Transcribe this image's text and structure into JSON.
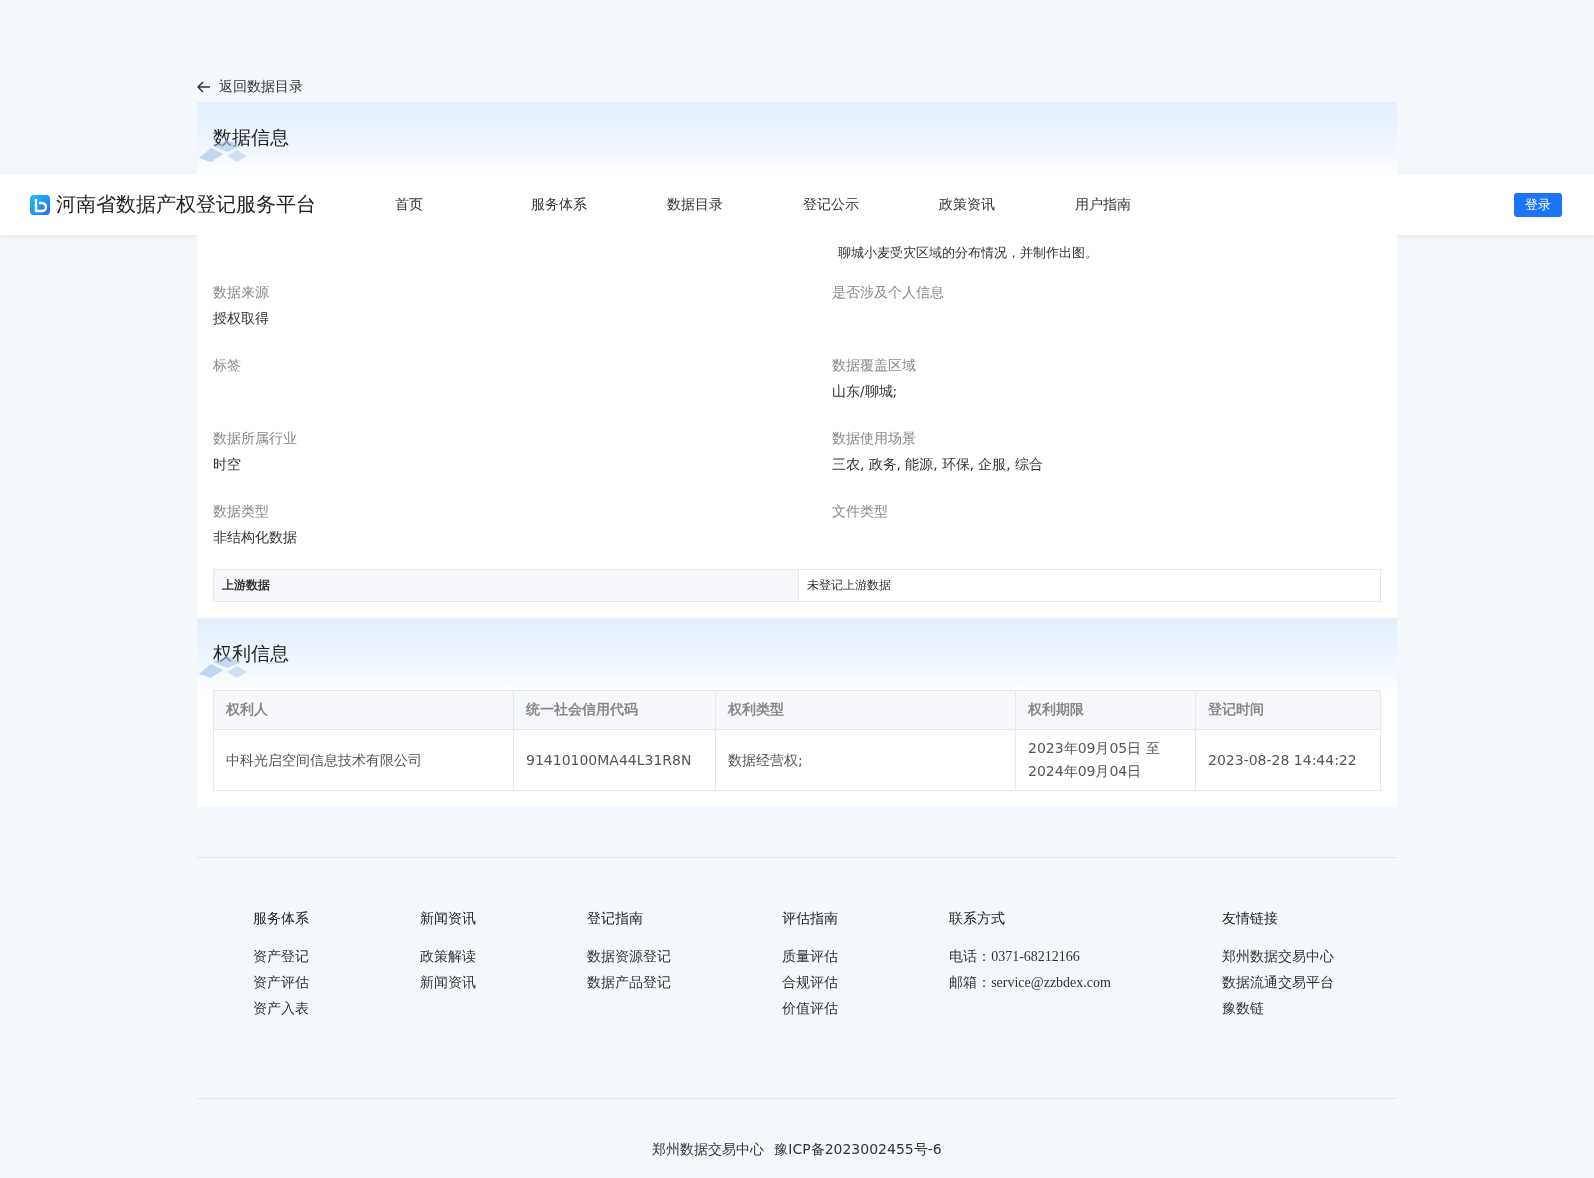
{
  "back_link": {
    "label": "返回数据目录"
  },
  "data_info": {
    "title": "数据信息",
    "description_tail": "聊城小麦受灾区域的分布情况，并制作出图。",
    "fields": [
      {
        "label": "数据来源",
        "value": "授权取得"
      },
      {
        "label": "是否涉及个人信息"
      },
      {
        "label": "标签"
      },
      {
        "label": "数据覆盖区域",
        "value": "山东/聊城;"
      },
      {
        "label": "数据所属行业",
        "value": "时空"
      },
      {
        "label": "数据使用场景",
        "value": "三农, 政务, 能源, 环保, 企服, 综合"
      },
      {
        "label": "数据类型",
        "value": "非结构化数据"
      },
      {
        "label": "文件类型"
      }
    ],
    "upstream": {
      "label": "上游数据",
      "value": "未登记上游数据"
    }
  },
  "header": {
    "logo_text": "河南省数据产权登记服务平台",
    "nav": [
      {
        "label": "首页"
      },
      {
        "label": "服务体系"
      },
      {
        "label": "数据目录"
      },
      {
        "label": "登记公示"
      },
      {
        "label": "政策资讯"
      },
      {
        "label": "用户指南"
      }
    ],
    "login": "登录"
  },
  "rights_info": {
    "title": "权利信息",
    "columns": [
      "权利人",
      "统一社会信用代码",
      "权利类型",
      "权利期限",
      "登记时间"
    ],
    "rows": [
      [
        "中科光启空间信息技术有限公司",
        "91410100MA44L31R8N",
        "数据经营权;",
        "2023年09月05日 至 2024年09月04日",
        "2023-08-28 14:44:22"
      ]
    ]
  },
  "footer": {
    "columns": [
      {
        "title": "服务体系",
        "links": [
          "资产登记",
          "资产评估",
          "资产入表"
        ]
      },
      {
        "title": "新闻资讯",
        "links": [
          "政策解读",
          "新闻资讯"
        ]
      },
      {
        "title": "登记指南",
        "links": [
          "数据资源登记",
          "数据产品登记"
        ]
      },
      {
        "title": "评估指南",
        "links": [
          "质量评估",
          "合规评估",
          "价值评估"
        ]
      },
      {
        "title": "联系方式",
        "links": [
          "电话：0371-68212166",
          "邮箱：service@zzbdex.com"
        ]
      },
      {
        "title": "友情链接",
        "links": [
          "郑州数据交易中心",
          "数据流通交易平台",
          "豫数链"
        ]
      }
    ],
    "copyright": [
      "郑州数据交易中心",
      "豫ICP备2023002455号-6"
    ]
  }
}
